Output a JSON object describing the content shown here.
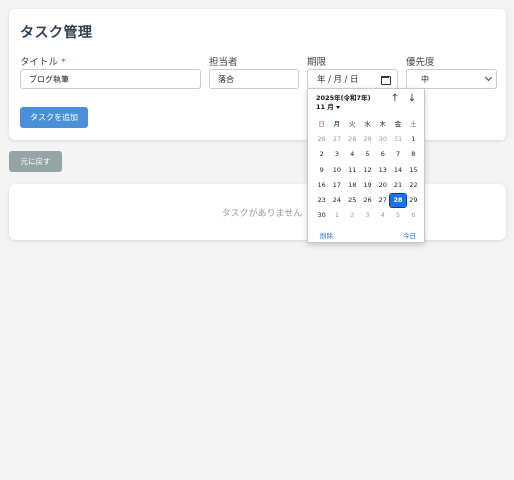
{
  "page": {
    "title": "タスク管理"
  },
  "form": {
    "title_label": "タイトル",
    "required_mark": "*",
    "title_value": "ブログ執筆",
    "assignee_label": "担当者",
    "assignee_value": "落合",
    "deadline_label": "期限",
    "deadline_year": "年",
    "deadline_sep1": "/",
    "deadline_month": "月",
    "deadline_sep2": "/",
    "deadline_day": "日",
    "priority_label": "優先度",
    "priority_value": "中",
    "add_button": "タスクを追加"
  },
  "back_button": "元に戻す",
  "task_list": {
    "empty_text": "タスクがありません"
  },
  "calendar": {
    "month_label": "2025年(令和7年) 11 月",
    "weekdays": [
      "日",
      "月",
      "火",
      "水",
      "木",
      "金",
      "土"
    ],
    "weeks": [
      [
        "26",
        "27",
        "28",
        "29",
        "30",
        "31",
        "1"
      ],
      [
        "2",
        "3",
        "4",
        "5",
        "6",
        "7",
        "8"
      ],
      [
        "9",
        "10",
        "11",
        "12",
        "13",
        "14",
        "15"
      ],
      [
        "16",
        "17",
        "18",
        "19",
        "20",
        "21",
        "22"
      ],
      [
        "23",
        "24",
        "25",
        "26",
        "27",
        "28",
        "29"
      ],
      [
        "30",
        "1",
        "2",
        "3",
        "4",
        "5",
        "6"
      ]
    ],
    "selected_day": "28",
    "clear_label": "削除",
    "today_label": "今日",
    "colors": {
      "sunday": "#d9534f",
      "saturday": "#3b6fc9",
      "selected": "#1a73e8"
    }
  },
  "colors": {
    "primary": "#4a90d9",
    "secondary": "#95a5a6",
    "required": "#e74c3c"
  }
}
